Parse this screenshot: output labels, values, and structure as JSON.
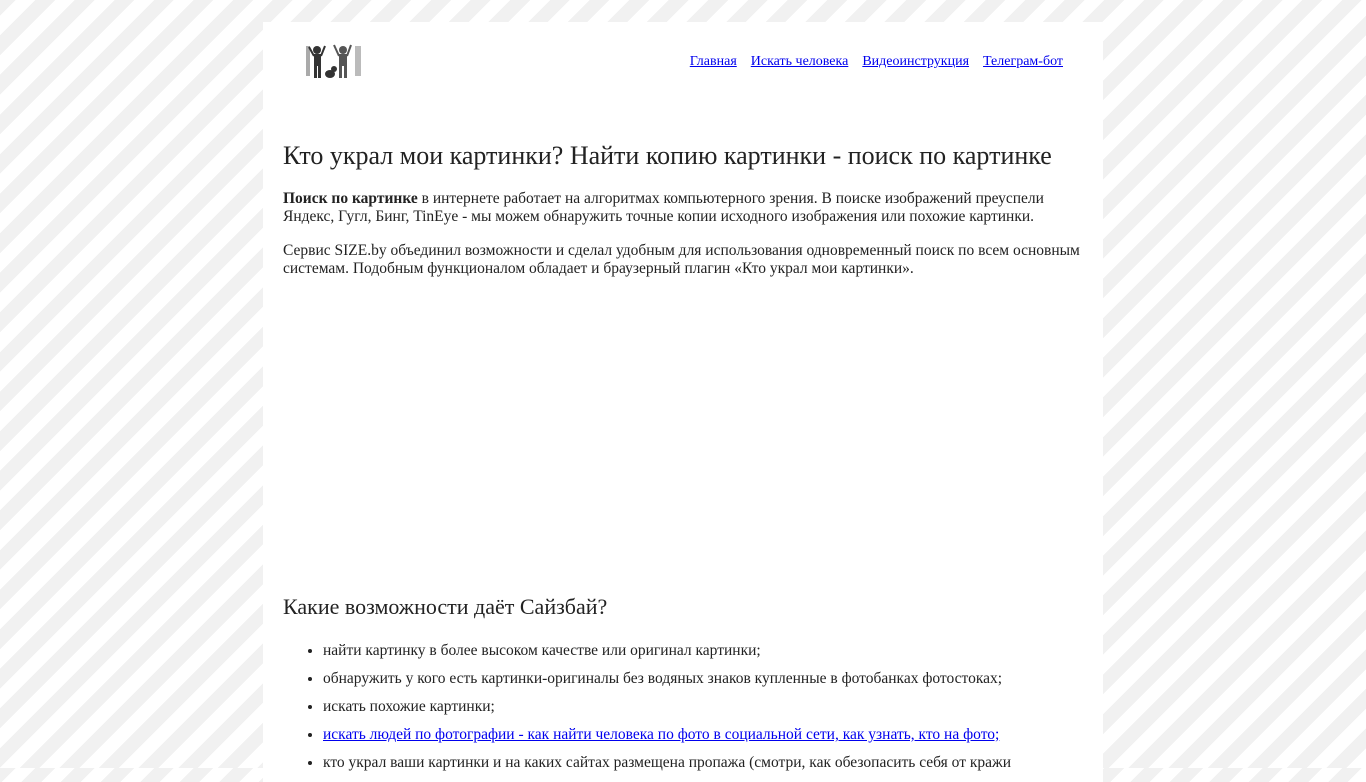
{
  "header": {
    "logo_name": "sizeby-logo",
    "nav": [
      {
        "label": "Главная"
      },
      {
        "label": "Искать человека"
      },
      {
        "label": "Видеоинструкция"
      },
      {
        "label": "Телеграм-бот"
      }
    ]
  },
  "main": {
    "title": "Кто украл мои картинки? Найти копию картинки - поиск по картинке",
    "intro_bold": "Поиск по картинке",
    "intro_rest": " в интернете работает на алгоритмах компьютерного зрения. В поиске изображений преуспели Яндекс, Гугл, Бинг, TinEye - мы можем обнаружить точные копии исходного изображения или похожие картинки.",
    "paragraph2": "Сервис SIZE.by объединил возможности и сделал удобным для использования одновременный поиск по всем основным системам. Подобным функционалом обладает и браузерный плагин «Кто украл мои картинки».",
    "section_title": "Какие возможности даёт Сайзбай?",
    "features": [
      {
        "text": "найти картинку в более высоком качестве или оригинал картинки;",
        "link": false
      },
      {
        "text": "обнаружить у кого есть картинки-оригиналы без водяных знаков купленные в фотобанках фотостоках;",
        "link": false
      },
      {
        "text": "искать похожие картинки;",
        "link": false
      },
      {
        "text": "искать людей по фотографии - как найти человека по фото в социальной сети, как узнать, кто на фото;",
        "link": true
      },
      {
        "text": "кто украл ваши картинки и на каких сайтах размещена пропажа (смотри, как обезопасить себя от кражи",
        "link": false
      }
    ]
  },
  "colors": {
    "link": "#0000ee",
    "stripe": "#f1f1f1"
  }
}
